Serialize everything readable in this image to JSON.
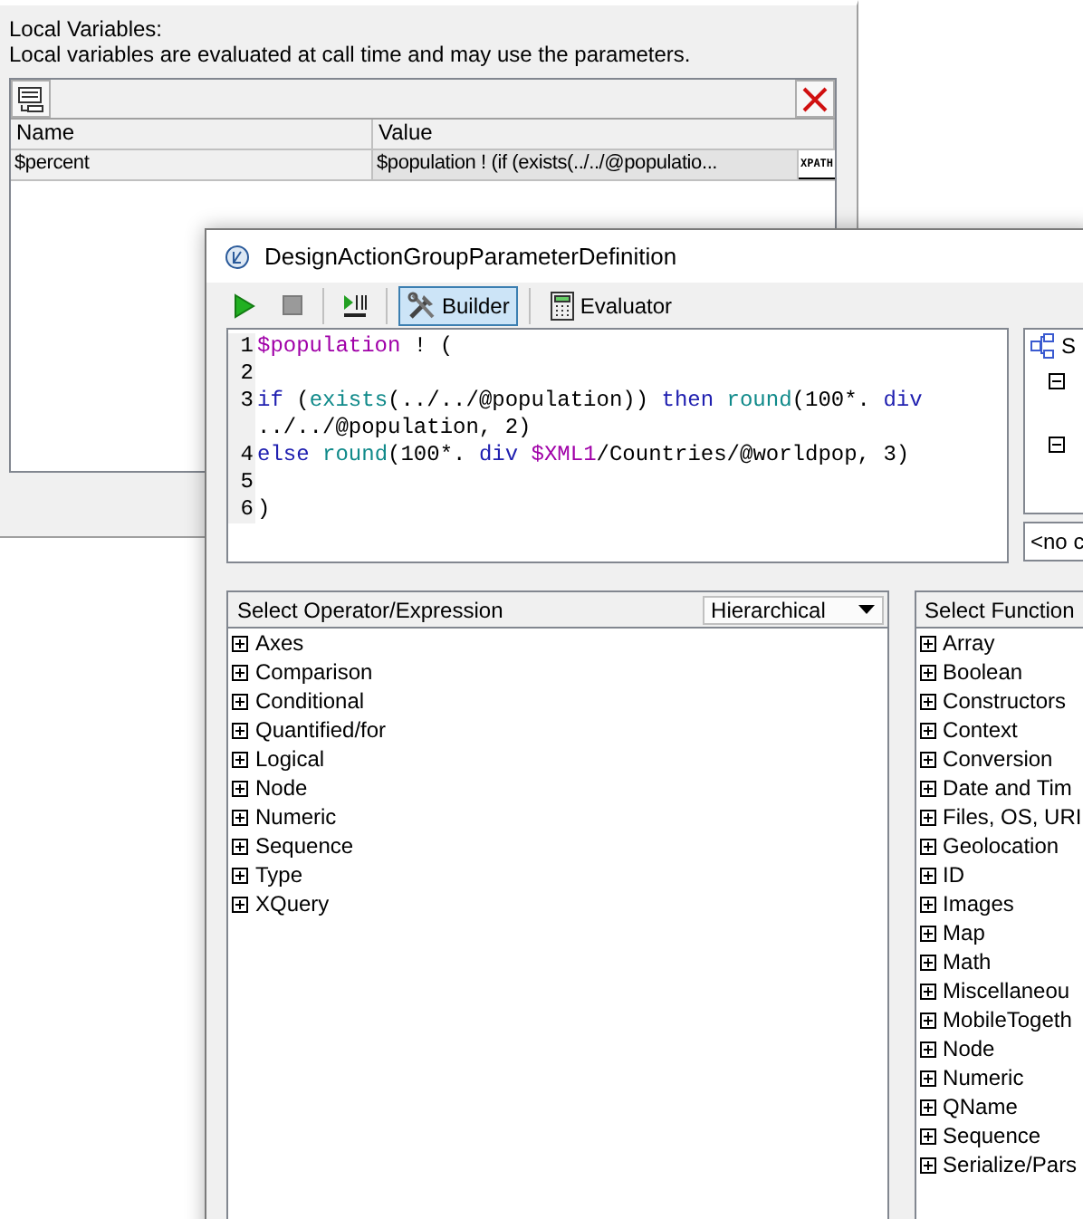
{
  "background_window": {
    "label": "Local Variables:",
    "description": "Local variables are evaluated at call time and may use the parameters.",
    "table": {
      "columns": [
        "Name",
        "Value"
      ],
      "rows": [
        {
          "name": "$percent",
          "value": "$population ! (if (exists(../../@populatio...",
          "button": "XPATH"
        }
      ]
    }
  },
  "dialog": {
    "title": "DesignActionGroupParameterDefinition",
    "tools": [
      {
        "kind": "run",
        "disabled": false
      },
      {
        "kind": "stop",
        "disabled": true
      },
      {
        "kind": "step",
        "disabled": false
      }
    ],
    "modes": [
      {
        "kind": "builder",
        "label": "Builder",
        "selected": true
      },
      {
        "kind": "evaluator",
        "label": "Evaluator",
        "selected": false
      }
    ],
    "code_lines": [
      {
        "number": "1",
        "tokens": [
          {
            "text": "$population",
            "kind": "variable"
          },
          {
            "text": " ! (",
            "kind": "plain"
          }
        ]
      },
      {
        "number": "2"
      },
      {
        "number": "3",
        "tokens": [
          {
            "text": "if",
            "kind": "keyword"
          },
          {
            "text": " (",
            "kind": "plain"
          },
          {
            "text": "exists",
            "kind": "function"
          },
          {
            "text": "(../../@population)) ",
            "kind": "plain"
          },
          {
            "text": "then ",
            "kind": "keyword"
          },
          {
            "text": "round",
            "kind": "function"
          },
          {
            "text": "(100*. ",
            "kind": "plain"
          },
          {
            "text": "div",
            "kind": "keyword"
          },
          {
            "text": " ../../@population, 2)",
            "kind": "plain"
          }
        ]
      },
      {
        "number": "4",
        "tokens": [
          {
            "text": "else ",
            "kind": "keyword"
          },
          {
            "text": "round",
            "kind": "function"
          },
          {
            "text": "(100*. ",
            "kind": "plain"
          },
          {
            "text": "div ",
            "kind": "keyword"
          },
          {
            "text": "$XML1",
            "kind": "variable"
          },
          {
            "text": "/Countries/@worldpop, 3)",
            "kind": "plain"
          }
        ]
      },
      {
        "number": "5"
      },
      {
        "number": "6",
        "tokens": [
          {
            "text": ")",
            "kind": "plain"
          }
        ]
      }
    ],
    "side_panel": {
      "tree_label": "S",
      "footer": "<no c"
    },
    "operator_panel": {
      "title": "Select Operator/Expression",
      "view_mode": "Hierarchical",
      "items": [
        "Axes",
        "Comparison",
        "Conditional",
        "Quantified/for",
        "Logical",
        "Node",
        "Numeric",
        "Sequence",
        "Type",
        "XQuery"
      ]
    },
    "function_panel": {
      "title": "Select Function",
      "items": [
        "Array",
        "Boolean",
        "Constructors",
        "Context",
        "Conversion",
        "Date and Tim",
        "Files, OS, URI",
        "Geolocation",
        "ID",
        "Images",
        "Map",
        "Math",
        "Miscellaneou",
        "MobileTogeth",
        "Node",
        "Numeric",
        "QName",
        "Sequence",
        "Serialize/Pars"
      ]
    }
  }
}
